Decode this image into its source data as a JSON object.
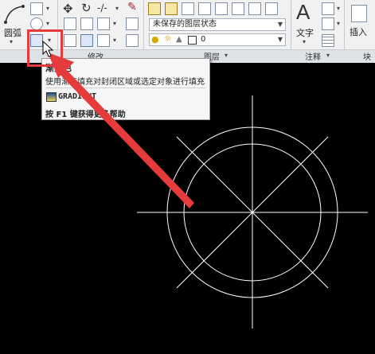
{
  "ribbon": {
    "arc_label": "圆弧",
    "modify_panel_label": "修改",
    "layer_panel_label": "图层",
    "annotation_panel_label": "注释",
    "block_panel_label": "块",
    "layer_state_combo": "未保存的图层状态",
    "layer_combo_value": "0",
    "text_button_label": "文字",
    "text_button_glyph": "A",
    "insert_button_label": "插入"
  },
  "tooltip": {
    "title": "渐变色",
    "description": "使用渐变填充对封闭区域或选定对象进行填充",
    "command": "GRADIENT",
    "help": "按 F1 键获得更多帮助"
  },
  "colors": {
    "highlight": "#e53b3b",
    "arrow": "#e53b3b",
    "canvas": "#000000",
    "drawing_lines": "#ffffff"
  },
  "icons": [
    "arc-icon",
    "line-icon",
    "move-icon",
    "rotate-icon",
    "trim-icon",
    "paint-icon",
    "layer-properties-icon",
    "gradient-icon",
    "lightbulb-icon",
    "sun-icon",
    "text-icon",
    "insert-block-icon",
    "table-icon"
  ]
}
